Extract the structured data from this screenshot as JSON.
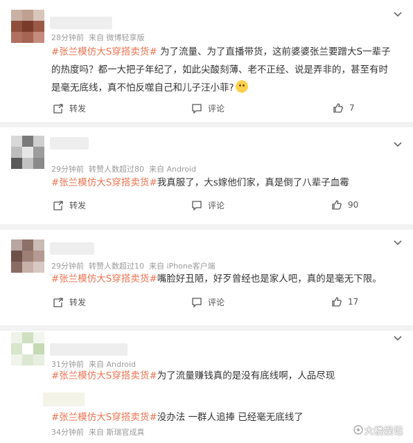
{
  "comments": [
    {
      "time": "28分钟前",
      "source_prefix": "来自",
      "source": "微博轻享版",
      "forward_note": "",
      "tag": "#张兰模仿大S穿搭卖货#",
      "text": "为了流量、为了直播带货，这前婆婆张兰要蹭大S一辈子的热度吗？都一大把子年纪了，如此尖酸刻薄、老不正经、说是弄非的，甚至有时是毫无底线，真不怕反噬自己和儿子汪小菲?",
      "forward_label": "转发",
      "comment_label": "评论",
      "like_count": "7"
    },
    {
      "time": "29分钟前",
      "source_prefix": "来自",
      "source": "Android",
      "forward_note": "转赞人数超过80",
      "tag": "#张兰模仿大S穿搭卖货#",
      "text": "我真服了，大s嫁他们家，真是倒了八辈子血霉",
      "forward_label": "转发",
      "comment_label": "评论",
      "like_count": "90"
    },
    {
      "time": "29分钟前",
      "source_prefix": "来自",
      "source": "iPhone客户端",
      "forward_note": "转赞人数超过10",
      "tag": "#张兰模仿大S穿搭卖货#",
      "text": "嘴脸好丑陋，好歹曾经也是家人吧，真的是毫无下限。",
      "forward_label": "转发",
      "comment_label": "评论",
      "like_count": "17"
    },
    {
      "time": "31分钟前",
      "source_prefix": "来自",
      "source": "Android",
      "forward_note": "",
      "tag": "#张兰模仿大S穿搭卖货#",
      "text": "为了流量赚钱真的是没有底线啊，人品尽现",
      "forward_label": "",
      "comment_label": "",
      "like_count": ""
    }
  ],
  "reply": {
    "tag": "#张兰模仿大S穿搭卖货#",
    "text": "没办法 一群人追捧 已经毫无底线了",
    "time": "34分钟前",
    "source_prefix": "来自",
    "source": "斯瑞官成真"
  },
  "watermark": "大楼娱记",
  "colors": {
    "tag": "#eb7350",
    "meta": "#9b9b9b",
    "divider": "#f2f2f2"
  }
}
